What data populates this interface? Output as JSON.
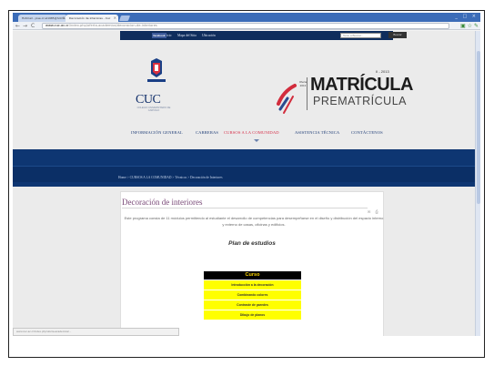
{
  "browser": {
    "tabs": [
      {
        "label": "Hotmail - jose.cruz1985@hotm..."
      },
      {
        "label": "Decoración de interiores - Cuc"
      }
    ],
    "close_glyph": "×",
    "window_controls": "_ □ ×",
    "url_host": "www.cuc.ac.cr",
    "url_path": "/index.php/oferta-academica/decoracion-de-interiores",
    "back_glyph": "←",
    "forward_glyph": "→",
    "reload_glyph": "C",
    "right_icons": "▣ ☆ ✎"
  },
  "topbar": {
    "facebook_label": "facebook",
    "links": [
      "Inicio",
      "Mapa del Sitio",
      "Ubicación"
    ],
    "search_placeholder": "Texto a Buscar...",
    "search_button": "Buscar"
  },
  "logo": {
    "text": "CUC",
    "subtitle": "COLEGIO UNIVERSITARIO DE CARTAGO"
  },
  "matricula": {
    "year": "II - 2013",
    "small": "Oferta 2013",
    "title": "MATRÍCULA",
    "subtitle": "PREMATRÍCULA"
  },
  "menu": [
    {
      "label": "INFORMACIÓN GENERAL",
      "active": false
    },
    {
      "label": "CARRERAS",
      "active": false
    },
    {
      "label": "CURSOS A LA COMUNIDAD",
      "active": true
    },
    {
      "label": "ASISTENCIA TÉCNICA",
      "active": false
    },
    {
      "label": "CONTÁCTENOS",
      "active": false
    }
  ],
  "breadcrumb": "Home  >  CURSOS A LA COMUNIDAD  >  Técnicos  >  Decoración de Interiores",
  "article": {
    "title": "Decoración de interiores",
    "icons": "✉ ⎙",
    "intro": "Este programa consta de 11 módulos permitiendo al estudiante el desarrollo de competencias para desempeñarse en el diseño y distribución del espacio interno y externo de casas, oficinas y edificios.",
    "plan_heading": "Plan de estudios",
    "table_header": "Curso",
    "courses": [
      "Introducción a la decoración",
      "Combinando colores",
      "Contraste de paredes",
      "Dibujo de planos"
    ]
  },
  "status_url": "www.cuc.ac.cr/index.php/oferta-academica/..."
}
